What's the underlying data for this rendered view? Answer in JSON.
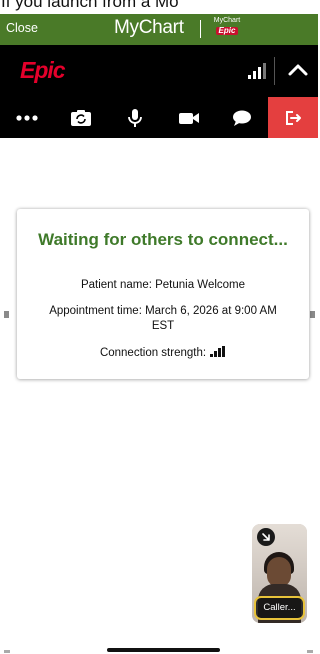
{
  "page": {
    "caption_text": "If you launch from a Mo"
  },
  "mychart_header": {
    "close_label": "Close",
    "logo_text": "MyChart",
    "mini_logo_top": "MyChart",
    "mini_logo_bottom": "Epic",
    "brand_color": "#4a7a28"
  },
  "epic_header": {
    "logo_text": "Epic",
    "logo_color": "#e4002b",
    "icons": [
      "signal-strength-icon",
      "chevron-up-icon"
    ]
  },
  "controls": {
    "icons": [
      "more-options-icon",
      "switch-camera-icon",
      "microphone-icon",
      "video-camera-icon",
      "chat-icon",
      "leave-call-icon"
    ],
    "leave_color": "#e43f3f"
  },
  "waiting_card": {
    "title": "Waiting for others to connect...",
    "patient_line": "Patient name: Petunia Welcome",
    "appointment_line": "Appointment time: March 6, 2026 at 9:00 AM EST",
    "connection_line": "Connection strength:",
    "title_color": "#3f7a2a"
  },
  "self_view": {
    "label": "Caller...",
    "expand_icon": "expand-arrow-icon"
  }
}
